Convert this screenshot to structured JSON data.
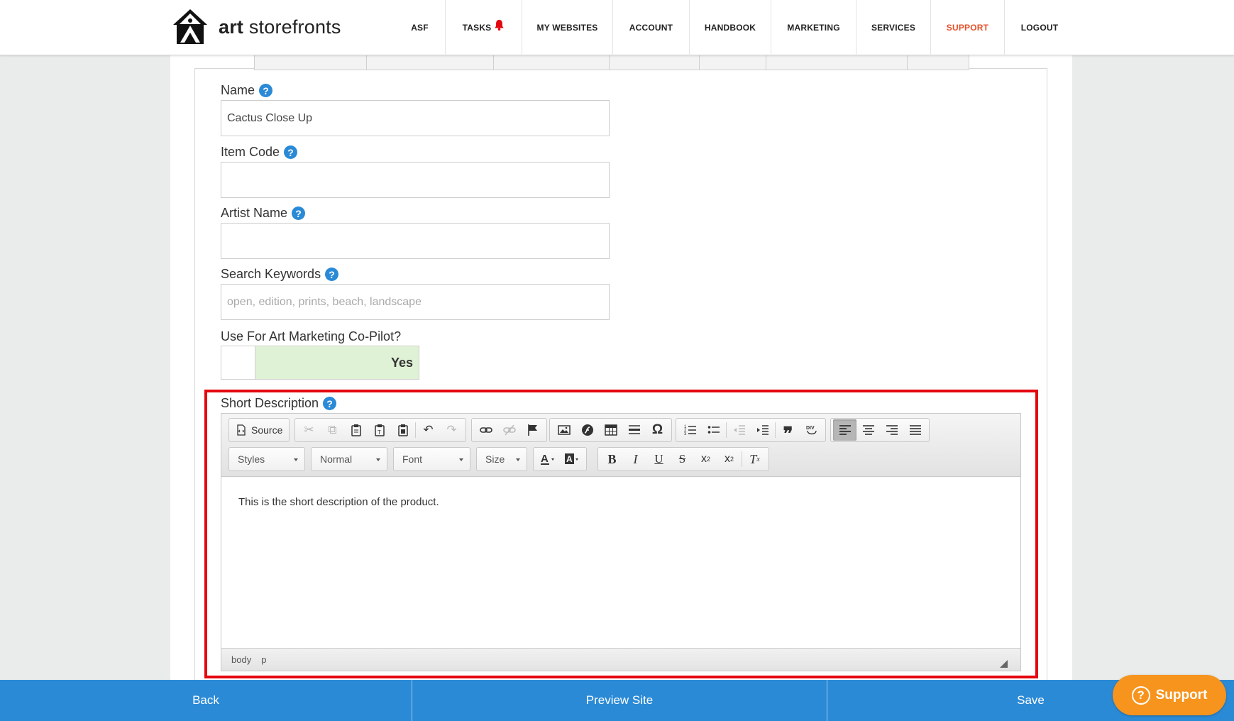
{
  "brand": {
    "logo_icon": "art-storefronts-house-icon",
    "name_bold": "art",
    "name_rest": " storefronts"
  },
  "nav": {
    "items": [
      {
        "label": "ASF"
      },
      {
        "label": "TASKS",
        "icon": "bell-icon"
      },
      {
        "label": "MY WEBSITES"
      },
      {
        "label": "ACCOUNT"
      },
      {
        "label": "HANDBOOK"
      },
      {
        "label": "MARKETING"
      },
      {
        "label": "SERVICES"
      },
      {
        "label": "SUPPORT",
        "active": true
      },
      {
        "label": "LOGOUT"
      }
    ]
  },
  "form": {
    "name": {
      "label": "Name",
      "value": "Cactus Close Up",
      "placeholder": ""
    },
    "item_code": {
      "label": "Item Code",
      "value": "",
      "placeholder": ""
    },
    "artist_name": {
      "label": "Artist Name",
      "value": "",
      "placeholder": ""
    },
    "search_keywords": {
      "label": "Search Keywords",
      "value": "",
      "placeholder": "open, edition, prints, beach, landscape"
    },
    "copilot": {
      "label": "Use For Art Marketing Co-Pilot?",
      "value": "Yes"
    },
    "short_description": {
      "label": "Short Description",
      "content": "This is the short description of the product.",
      "path": [
        "body",
        "p"
      ]
    }
  },
  "editor": {
    "source_label": "Source",
    "styles_label": "Styles",
    "format_label": "Normal",
    "font_label": "Font",
    "size_label": "Size"
  },
  "bottom": {
    "back": "Back",
    "preview": "Preview Site",
    "save": "Save"
  },
  "support_button": "Support",
  "help_glyph": "?",
  "colors": {
    "accent_blue": "#2b8ad6",
    "active_nav": "#e4512a",
    "highlight_red": "#e4070f",
    "support_orange": "#f7941d",
    "toggle_green": "#dff2d6"
  }
}
